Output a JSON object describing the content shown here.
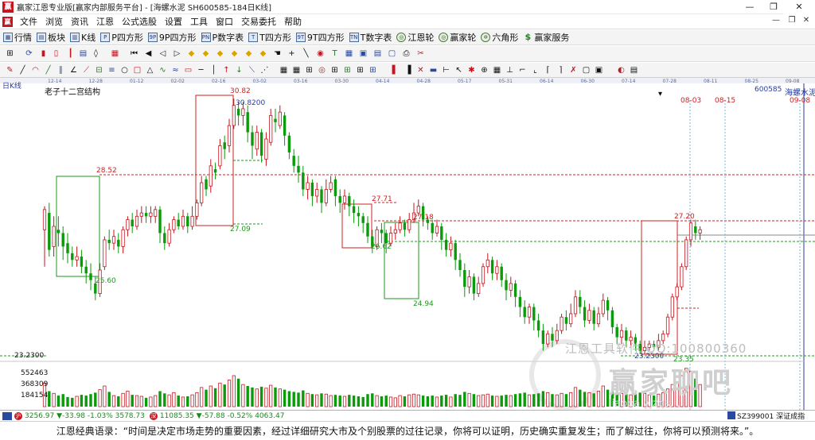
{
  "window": {
    "title": "赢家江恩专业版[赢家内部服务平台] - [海螺水泥  SH600585-184日K线]",
    "controls": [
      "—",
      "❐",
      "✕"
    ]
  },
  "menu": {
    "items": [
      "文件",
      "浏览",
      "资讯",
      "江恩",
      "公式选股",
      "设置",
      "工具",
      "窗口",
      "交易委托",
      "帮助"
    ],
    "mdi_controls": [
      "—",
      "❐",
      "✕"
    ]
  },
  "toolbar1": {
    "items": [
      {
        "icon": "▦",
        "label": "行情"
      },
      {
        "icon": "▤",
        "label": "板块"
      },
      {
        "icon": "▥",
        "label": "K线"
      },
      {
        "icon": "P",
        "label": "P四方形"
      },
      {
        "icon": "9P",
        "label": "9P四方形"
      },
      {
        "icon": "PN",
        "label": "P数字表"
      },
      {
        "icon": "T",
        "label": "T四方形"
      },
      {
        "icon": "9T",
        "label": "9T四方形"
      },
      {
        "icon": "TN",
        "label": "T数字表"
      },
      {
        "icon": "◎",
        "label": "江恩轮"
      },
      {
        "icon": "◎",
        "label": "赢家轮"
      },
      {
        "icon": "✡",
        "label": "六角形"
      },
      {
        "icon": "$",
        "label": "赢家服务"
      }
    ]
  },
  "chart": {
    "period_label": "日K线",
    "study_name": "老子十二宫结构",
    "stock_code": "600585",
    "stock_name": "海螺水泥",
    "left_axis_label": "23.2300",
    "vol_ticks": [
      "552463",
      "368309",
      "184154"
    ],
    "date_ticks": [
      "12-14",
      "12-28",
      "01-12",
      "02-02",
      "02-16",
      "03-02",
      "03-16",
      "03-30",
      "04-14",
      "04-28",
      "05-17",
      "05-31",
      "06-14",
      "06-30",
      "07-14",
      "07-28",
      "08-11",
      "08-25",
      "09-08"
    ],
    "future_dates": [
      "08-03",
      "08-15",
      "09-08"
    ],
    "price_labels": {
      "p3082": "30.82",
      "p30820": "30.8200",
      "p2852": "28.52",
      "p2709": "27.09",
      "p2771": "27.71",
      "p2718": "27.18",
      "p2662": "26.62",
      "p2720": "27.20",
      "p2560": "25.60",
      "p2494": "24.94",
      "p2335": "23.35",
      "p23230": "23.2300"
    },
    "watermark_text": "江恩工具软件  QQ:100800360",
    "watermark_brand": "赢家聊吧",
    "watermark_url": "liaoba.yjzqs..."
  },
  "chart_data": {
    "type": "candlestick",
    "title": "老子十二宫结构",
    "x_range": [
      "12-14",
      "09-08"
    ],
    "price_range": [
      23.23,
      30.82
    ],
    "annotated_levels": [
      30.82,
      28.52,
      27.71,
      27.2,
      27.18,
      27.09,
      26.62,
      25.6,
      24.94,
      23.35,
      23.23
    ],
    "series": [
      {
        "name": "海螺水泥",
        "ohlc": [
          [
            26.9,
            27.5,
            27.6,
            25.8
          ],
          [
            27.4,
            26.3,
            27.7,
            26.1
          ],
          [
            26.4,
            27.0,
            27.3,
            26.1
          ],
          [
            26.9,
            26.8,
            27.3,
            26.4
          ],
          [
            26.8,
            26.4,
            27.0,
            26.0
          ],
          [
            26.5,
            26.2,
            26.8,
            25.9
          ],
          [
            26.2,
            26.0,
            26.4,
            25.8
          ],
          [
            26.0,
            26.1,
            26.4,
            25.8
          ],
          [
            26.1,
            25.8,
            26.3,
            25.6
          ],
          [
            25.8,
            25.6,
            26.0,
            25.3
          ],
          [
            25.6,
            25.4,
            25.9,
            25.1
          ],
          [
            25.3,
            25.0,
            25.5,
            24.8
          ],
          [
            25.0,
            25.7,
            25.9,
            24.9
          ],
          [
            25.8,
            26.6,
            26.7,
            25.7
          ],
          [
            26.6,
            26.5,
            26.9,
            26.3
          ],
          [
            26.5,
            26.7,
            26.9,
            26.3
          ],
          [
            26.6,
            26.4,
            26.8,
            26.2
          ],
          [
            26.4,
            26.9,
            27.0,
            26.2
          ],
          [
            26.9,
            27.2,
            27.3,
            26.7
          ],
          [
            27.2,
            27.0,
            27.4,
            26.8
          ],
          [
            27.0,
            27.3,
            27.5,
            26.9
          ],
          [
            27.3,
            27.4,
            27.6,
            27.1
          ],
          [
            27.4,
            27.3,
            27.6,
            27.1
          ],
          [
            27.3,
            27.4,
            27.6,
            27.1
          ],
          [
            27.3,
            27.5,
            27.6,
            27.1
          ],
          [
            27.5,
            26.8,
            27.6,
            26.5
          ],
          [
            26.8,
            26.5,
            27.0,
            26.3
          ],
          [
            26.5,
            26.9,
            27.1,
            26.4
          ],
          [
            26.9,
            27.2,
            27.3,
            26.8
          ],
          [
            27.2,
            27.0,
            27.4,
            26.9
          ],
          [
            27.0,
            27.3,
            27.5,
            26.9
          ],
          [
            27.3,
            27.0,
            27.4,
            26.8
          ],
          [
            27.0,
            27.3,
            27.6,
            26.9
          ],
          [
            27.3,
            27.7,
            27.8,
            27.2
          ],
          [
            27.7,
            28.3,
            28.5,
            27.6
          ],
          [
            28.4,
            28.1,
            28.5,
            27.9
          ],
          [
            28.2,
            28.8,
            29.0,
            28.0
          ],
          [
            28.7,
            28.6,
            28.9,
            28.4
          ],
          [
            28.8,
            29.4,
            29.6,
            28.7
          ],
          [
            29.5,
            29.3,
            29.7,
            29.0
          ],
          [
            29.4,
            30.0,
            30.2,
            29.2
          ],
          [
            30.0,
            30.6,
            30.8,
            29.9
          ],
          [
            30.5,
            30.3,
            30.7,
            30.0
          ],
          [
            30.3,
            30.5,
            30.7,
            30.0
          ],
          [
            30.4,
            29.8,
            30.6,
            29.5
          ],
          [
            29.8,
            29.4,
            30.0,
            29.0
          ],
          [
            29.3,
            29.8,
            30.0,
            29.1
          ],
          [
            29.8,
            29.1,
            29.9,
            28.9
          ],
          [
            29.0,
            29.6,
            29.8,
            28.8
          ],
          [
            29.5,
            30.3,
            30.5,
            29.4
          ],
          [
            30.2,
            30.1,
            30.5,
            29.8
          ],
          [
            30.0,
            30.4,
            30.6,
            29.9
          ],
          [
            30.3,
            29.7,
            30.4,
            29.4
          ],
          [
            29.7,
            29.2,
            29.8,
            29.0
          ],
          [
            29.1,
            28.8,
            29.3,
            28.6
          ],
          [
            28.8,
            28.6,
            29.1,
            28.3
          ],
          [
            28.6,
            28.1,
            28.8,
            27.9
          ],
          [
            28.1,
            28.3,
            28.5,
            27.8
          ],
          [
            28.3,
            27.9,
            28.4,
            27.6
          ],
          [
            27.9,
            28.1,
            28.3,
            27.7
          ],
          [
            28.1,
            27.7,
            28.2,
            27.4
          ],
          [
            27.7,
            28.1,
            28.4,
            27.6
          ],
          [
            28.1,
            28.3,
            28.5,
            28.0
          ],
          [
            28.4,
            27.9,
            28.5,
            27.6
          ],
          [
            27.9,
            27.7,
            28.1,
            27.4
          ],
          [
            27.7,
            27.9,
            28.1,
            27.5
          ],
          [
            27.9,
            27.6,
            28.0,
            27.3
          ],
          [
            27.6,
            27.4,
            27.8,
            27.1
          ],
          [
            27.4,
            27.3,
            27.6,
            27.0
          ],
          [
            27.3,
            27.1,
            27.4,
            26.8
          ],
          [
            27.1,
            26.7,
            27.3,
            26.5
          ],
          [
            26.7,
            26.4,
            26.9,
            26.2
          ],
          [
            26.4,
            26.9,
            27.0,
            26.3
          ],
          [
            26.9,
            26.8,
            27.1,
            26.5
          ],
          [
            26.8,
            26.5,
            26.9,
            26.2
          ],
          [
            26.5,
            26.8,
            27.0,
            26.4
          ],
          [
            26.8,
            26.9,
            27.1,
            26.6
          ],
          [
            26.9,
            27.1,
            27.3,
            26.8
          ],
          [
            27.1,
            26.9,
            27.2,
            26.7
          ],
          [
            26.9,
            27.2,
            27.4,
            26.8
          ],
          [
            27.2,
            27.4,
            27.7,
            27.1
          ],
          [
            27.4,
            27.6,
            27.8,
            27.3
          ],
          [
            27.6,
            27.2,
            27.7,
            27.0
          ],
          [
            27.2,
            27.1,
            27.3,
            26.9
          ],
          [
            27.1,
            26.8,
            27.2,
            26.6
          ],
          [
            26.8,
            27.0,
            27.2,
            26.7
          ],
          [
            27.0,
            26.6,
            27.1,
            26.3
          ],
          [
            26.6,
            26.3,
            26.8,
            26.1
          ],
          [
            26.3,
            26.5,
            26.7,
            26.1
          ],
          [
            26.5,
            26.0,
            26.6,
            25.7
          ],
          [
            26.0,
            25.7,
            26.2,
            25.5
          ],
          [
            25.7,
            25.2,
            25.9,
            24.9
          ],
          [
            25.2,
            25.5,
            25.7,
            25.0
          ],
          [
            25.5,
            25.0,
            25.6,
            24.8
          ],
          [
            25.0,
            25.3,
            25.5,
            24.9
          ],
          [
            25.3,
            25.8,
            25.9,
            25.2
          ],
          [
            25.8,
            26.0,
            26.2,
            25.6
          ],
          [
            26.0,
            25.6,
            26.1,
            25.4
          ],
          [
            25.6,
            25.8,
            26.0,
            25.4
          ],
          [
            25.8,
            25.4,
            25.9,
            25.2
          ],
          [
            25.4,
            25.1,
            25.6,
            24.8
          ],
          [
            25.1,
            25.3,
            25.5,
            24.9
          ],
          [
            25.3,
            24.9,
            25.4,
            24.6
          ],
          [
            24.9,
            24.6,
            25.1,
            24.3
          ],
          [
            24.6,
            24.3,
            24.8,
            24.1
          ],
          [
            24.3,
            24.6,
            24.7,
            24.1
          ],
          [
            24.6,
            24.2,
            24.7,
            23.9
          ],
          [
            24.2,
            23.9,
            24.4,
            23.7
          ],
          [
            23.9,
            23.5,
            24.1,
            23.3
          ],
          [
            23.5,
            23.8,
            23.9,
            23.4
          ],
          [
            23.8,
            23.6,
            24.0,
            23.4
          ],
          [
            23.6,
            23.9,
            24.1,
            23.5
          ],
          [
            23.9,
            24.3,
            24.4,
            23.8
          ],
          [
            24.3,
            24.1,
            24.5,
            23.9
          ],
          [
            24.1,
            24.4,
            24.7,
            24.0
          ],
          [
            24.4,
            24.9,
            25.1,
            24.3
          ],
          [
            24.9,
            24.6,
            25.1,
            24.4
          ],
          [
            24.6,
            24.2,
            24.8,
            24.0
          ],
          [
            24.2,
            24.5,
            24.7,
            24.1
          ],
          [
            24.5,
            24.1,
            24.6,
            23.9
          ],
          [
            24.1,
            24.4,
            24.6,
            24.0
          ],
          [
            24.4,
            24.8,
            25.0,
            24.3
          ],
          [
            24.8,
            24.5,
            24.9,
            24.2
          ],
          [
            24.5,
            24.0,
            24.6,
            23.8
          ],
          [
            24.0,
            23.7,
            24.1,
            23.5
          ],
          [
            23.7,
            23.9,
            24.1,
            23.5
          ],
          [
            23.9,
            23.6,
            24.0,
            23.4
          ],
          [
            23.6,
            23.7,
            23.9,
            23.4
          ],
          [
            23.7,
            23.5,
            23.8,
            23.3
          ],
          [
            23.5,
            23.3,
            23.6,
            23.2
          ],
          [
            23.3,
            23.4,
            23.6,
            23.2
          ],
          [
            23.4,
            23.5,
            23.6,
            23.3
          ],
          [
            23.5,
            23.4,
            23.6,
            23.3
          ],
          [
            23.4,
            23.6,
            23.8,
            23.3
          ],
          [
            23.6,
            23.8,
            23.9,
            23.5
          ],
          [
            23.8,
            24.3,
            24.4,
            23.7
          ],
          [
            24.3,
            24.9,
            25.0,
            24.2
          ],
          [
            24.9,
            25.2,
            25.3,
            24.8
          ],
          [
            25.2,
            25.8,
            25.9,
            25.1
          ],
          [
            25.8,
            26.6,
            26.7,
            25.7
          ],
          [
            26.6,
            27.1,
            27.2,
            26.4
          ],
          [
            27.0,
            26.8,
            27.2,
            26.6
          ],
          [
            26.8,
            26.9,
            27.0,
            26.6
          ]
        ]
      },
      {
        "name": "volume",
        "values": [
          320000,
          210000,
          180000,
          150000,
          170000,
          130000,
          120000,
          140000,
          160000,
          150000,
          170000,
          190000,
          230000,
          280000,
          200000,
          150000,
          140000,
          180000,
          210000,
          160000,
          150000,
          140000,
          120000,
          130000,
          150000,
          210000,
          180000,
          160000,
          190000,
          150000,
          130000,
          140000,
          160000,
          190000,
          260000,
          230000,
          280000,
          250000,
          320000,
          300000,
          360000,
          420000,
          380000,
          300000,
          280000,
          260000,
          240000,
          270000,
          250000,
          290000,
          260000,
          240000,
          230000,
          210000,
          200000,
          190000,
          220000,
          180000,
          170000,
          160000,
          180000,
          170000,
          150000,
          160000,
          150000,
          140000,
          160000,
          150000,
          140000,
          130000,
          170000,
          180000,
          150000,
          140000,
          150000,
          130000,
          120000,
          150000,
          140000,
          160000,
          170000,
          160000,
          150000,
          140000,
          150000,
          130000,
          150000,
          160000,
          130000,
          170000,
          160000,
          200000,
          180000,
          170000,
          150000,
          160000,
          170000,
          150000,
          140000,
          150000,
          160000,
          150000,
          170000,
          180000,
          190000,
          160000,
          170000,
          180000,
          210000,
          190000,
          170000,
          160000,
          180000,
          170000,
          190000,
          260000,
          230000,
          200000,
          190000,
          180000,
          210000,
          280000,
          230000,
          210000,
          200000,
          180000,
          170000,
          160000,
          170000,
          190000,
          180000,
          160000,
          150000,
          170000,
          190000,
          240000,
          300000,
          340000,
          420000,
          520000,
          480000,
          380000,
          300000
        ]
      }
    ]
  },
  "indexbar": {
    "sh_value": "3256.97",
    "sh_change": "▼-33.98",
    "sh_pct": "-1.03%",
    "sh_amount": "3578.73",
    "sz_value": "11085.35",
    "sz_change": "▼-57.88",
    "sz_pct": "-0.52%",
    "sz_amount": "4063.47",
    "right_code": "SZ399001 深证成指"
  },
  "quote": {
    "text": "江恩经典语录：“时间是决定市场走势的重要因素，经过详细研究大市及个别股票的过往记录，你将可以证明，历史确实重复发生；而了解过往，你将可以预测将来。”。"
  },
  "colors": {
    "up": "#c8141e",
    "down": "#0a9a0a",
    "box_red": "#cc2020",
    "box_green": "#1a9a1a",
    "axis_blue": "#2a3c9a",
    "toolbar_bg": "#f4f4f4"
  }
}
